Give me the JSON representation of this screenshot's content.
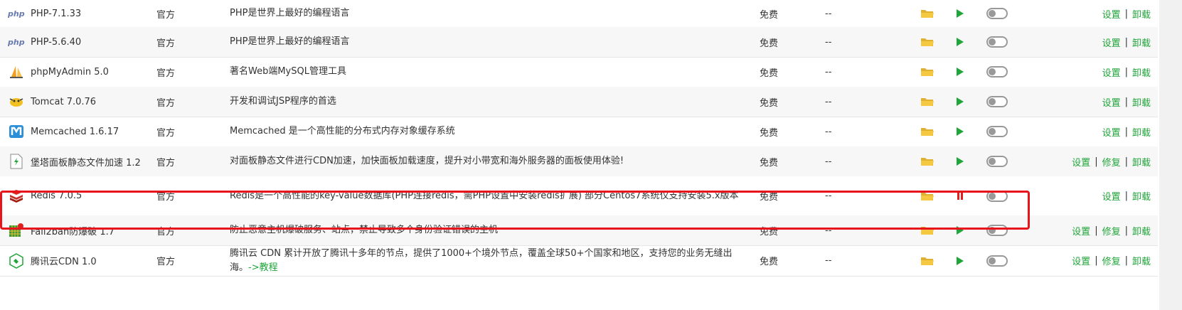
{
  "plugins": [
    {
      "icon": "php-icon",
      "name": "PHP-7.1.33",
      "type": "官方",
      "desc": "PHP是世界上最好的编程语言",
      "desc2": "",
      "price": "免费",
      "expire": "--",
      "state": "play",
      "ops": [
        "设置",
        "卸载"
      ]
    },
    {
      "icon": "php-icon",
      "name": "PHP-5.6.40",
      "type": "官方",
      "desc": "PHP是世界上最好的编程语言",
      "desc2": "",
      "price": "免费",
      "expire": "--",
      "state": "play",
      "ops": [
        "设置",
        "卸载"
      ]
    },
    {
      "icon": "phpmyadmin-icon",
      "name": "phpMyAdmin 5.0",
      "type": "官方",
      "desc": "著名Web端MySQL管理工具",
      "desc2": "",
      "price": "免费",
      "expire": "--",
      "state": "play",
      "ops": [
        "设置",
        "卸载"
      ]
    },
    {
      "icon": "tomcat-icon",
      "name": "Tomcat 7.0.76",
      "type": "官方",
      "desc": "开发和调试JSP程序的首选",
      "desc2": "",
      "price": "免费",
      "expire": "--",
      "state": "play",
      "ops": [
        "设置",
        "卸载"
      ]
    },
    {
      "icon": "memcached-icon",
      "name": "Memcached 1.6.17",
      "type": "官方",
      "desc": "Memcached 是一个高性能的分布式内存对象缓存系统",
      "desc2": "",
      "price": "免费",
      "expire": "--",
      "state": "play",
      "ops": [
        "设置",
        "卸载"
      ]
    },
    {
      "icon": "static-accel-icon",
      "name": "堡塔面板静态文件加速 1.2",
      "type": "官方",
      "desc": "对面板静态文件进行CDN加速，加快面板加载速度，提升对小带宽和海外服务器的面板使用体验!",
      "desc2": "",
      "price": "免费",
      "expire": "--",
      "state": "play",
      "ops": [
        "设置",
        "修复",
        "卸载"
      ]
    },
    {
      "icon": "redis-icon",
      "name": "Redis 7.0.5",
      "type": "官方",
      "desc": "Redis是一个高性能的key-value数据库(PHP连接redis，需PHP设置中安装redis扩展) 部分Centos7系统仅支持安装5.x版本",
      "desc2": "",
      "price": "免费",
      "expire": "--",
      "state": "pause",
      "ops": [
        "设置",
        "卸载"
      ]
    },
    {
      "icon": "fail2ban-icon",
      "name": "Fail2ban防爆破 1.7",
      "type": "官方",
      "desc": "防止恶意主机爆破服务、站点，禁止导致多个身份验证错误的主机",
      "desc2": "",
      "price": "免费",
      "expire": "--",
      "state": "play",
      "ops": [
        "设置",
        "修复",
        "卸载"
      ]
    },
    {
      "icon": "tencent-cdn-icon",
      "name": "腾讯云CDN 1.0",
      "type": "官方",
      "desc": "腾讯云 CDN 累计开放了腾讯十多年的节点，提供了1000+个境外节点，覆盖全球50+个国家和地区，支持您的业务无缝出海。",
      "desc2": "->教程",
      "price": "免费",
      "expire": "--",
      "state": "play",
      "ops": [
        "设置",
        "修复",
        "卸载"
      ]
    }
  ],
  "colors": {
    "accent": "#20a53a",
    "stop": "#e02020",
    "folder": "#f0c040",
    "highlight": "#e8141b"
  }
}
